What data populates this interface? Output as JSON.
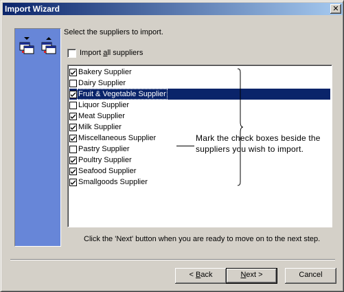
{
  "window": {
    "title": "Import Wizard",
    "close_glyph": "✕"
  },
  "main": {
    "instruction": "Select the suppliers to import.",
    "import_all_prefix": "Import ",
    "import_all_underline": "a",
    "import_all_suffix": "ll suppliers",
    "import_all_checked": false
  },
  "suppliers": [
    {
      "label": "Bakery Supplier",
      "checked": true
    },
    {
      "label": "Dairy Supplier",
      "checked": false
    },
    {
      "label": "Fruit & Vegetable Supplier",
      "checked": true,
      "selected": true
    },
    {
      "label": "Liquor Supplier",
      "checked": false
    },
    {
      "label": "Meat Supplier",
      "checked": true
    },
    {
      "label": "Milk Supplier",
      "checked": true
    },
    {
      "label": "Miscellaneous Supplier",
      "checked": true
    },
    {
      "label": "Pastry Supplier",
      "checked": false
    },
    {
      "label": "Poultry Supplier",
      "checked": true
    },
    {
      "label": "Seafood Supplier",
      "checked": true
    },
    {
      "label": "Smallgoods Supplier",
      "checked": true
    }
  ],
  "callout": {
    "line1": "Mark the check boxes beside the",
    "line2": "suppliers you wish to import."
  },
  "footer": {
    "hint": "Click the 'Next' button when you are ready to move on to the next step.",
    "back_prefix": "< ",
    "back_underline": "B",
    "back_suffix": "ack",
    "next_underline": "N",
    "next_suffix": "ext >",
    "cancel_label": "Cancel"
  },
  "colors": {
    "side_panel": "#6786d8",
    "selection": "#0a246a",
    "title_start": "#0a246a",
    "title_end": "#a6caf0",
    "face": "#d4d0c8"
  }
}
